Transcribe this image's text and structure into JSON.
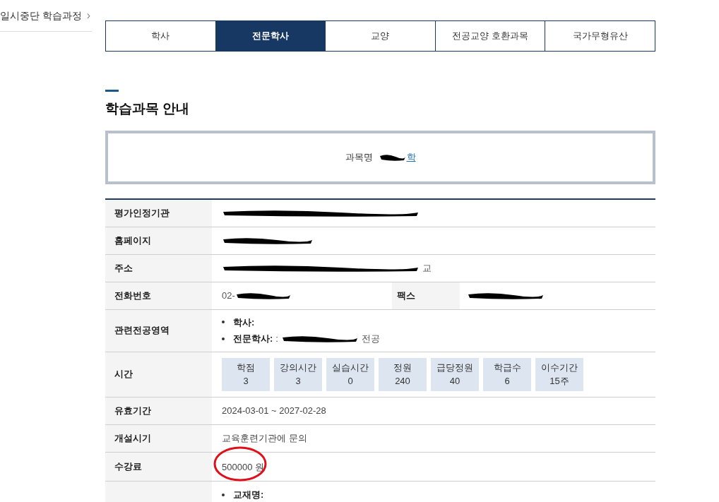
{
  "breadcrumb": {
    "label": "일시중단 학습과정",
    "chevron": "›"
  },
  "tabs": [
    {
      "label": "학사",
      "selected": false
    },
    {
      "label": "전문학사",
      "selected": true
    },
    {
      "label": "교양",
      "selected": false
    },
    {
      "label": "전공교양 호환과목",
      "selected": false
    },
    {
      "label": "국가무형유산",
      "selected": false
    }
  ],
  "section_title": "학습과목 안내",
  "course": {
    "label": "과목명",
    "name": "학"
  },
  "info_rows": [
    {
      "kind": "redacted",
      "label": "평가인정기관",
      "text_before": "",
      "text_after": ""
    },
    {
      "kind": "redacted",
      "label": "홈페이지",
      "text_before": "",
      "text_after": ""
    },
    {
      "kind": "redacted",
      "label": "주소",
      "text_before": "",
      "text_after": "교"
    },
    {
      "kind": "split",
      "label": "전화번호",
      "value": "02-",
      "label2": "팩스",
      "value2": ""
    },
    {
      "kind": "bullets",
      "label": "관련전공영역",
      "items": [
        {
          "term": "학사:",
          "value": ""
        },
        {
          "term": "전문학사:",
          "value": ": ",
          "tail": "전공"
        }
      ]
    },
    {
      "kind": "stats",
      "label": "시간",
      "stats": [
        {
          "name": "학점",
          "value": "3"
        },
        {
          "name": "강의시간",
          "value": "3"
        },
        {
          "name": "실습시간",
          "value": "0"
        },
        {
          "name": "정원",
          "value": "240"
        },
        {
          "name": "급당정원",
          "value": "40"
        },
        {
          "name": "학급수",
          "value": "6"
        },
        {
          "name": "이수기간",
          "value": "15주"
        }
      ]
    },
    {
      "kind": "text",
      "label": "유효기간",
      "value": "2024-03-01 ~ 2027-02-28"
    },
    {
      "kind": "text",
      "label": "개설시기",
      "value": "교육훈련기관에 문의"
    },
    {
      "kind": "circled",
      "label": "수강료",
      "value": "500000 원"
    },
    {
      "kind": "bullets",
      "label": "",
      "items": [
        {
          "term": "교재명:",
          "value": ""
        }
      ]
    }
  ]
}
